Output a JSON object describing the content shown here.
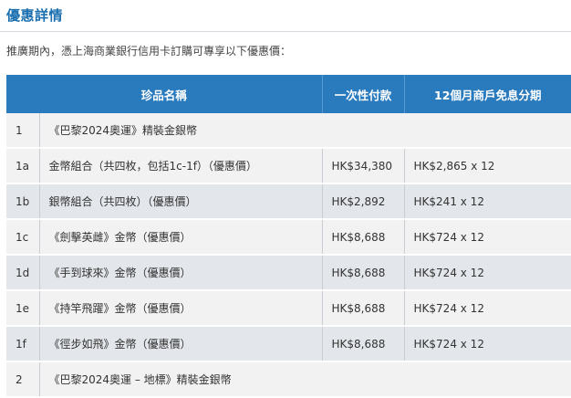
{
  "section_title": "優惠詳情",
  "intro": "推廣期內，憑上海商業銀行信用卡訂購可專享以下優惠價：",
  "table": {
    "headers": {
      "item": "珍品名稱",
      "lump_sum": "一次性付款",
      "installment": "12個月商戶免息分期"
    },
    "rows": [
      {
        "id": "1",
        "name": "《巴黎2024奧運》精裝金銀幣",
        "price": "",
        "installment": "",
        "group": true
      },
      {
        "id": "1a",
        "name": "金幣組合（共四枚，包括1c-1f）（優惠價）",
        "price": "HK$34,380",
        "installment": "HK$2,865 x 12"
      },
      {
        "id": "1b",
        "name": "銀幣組合（共四枚）（優惠價）",
        "price": "HK$2,892",
        "installment": "HK$241 x 12"
      },
      {
        "id": "1c",
        "name": "《劍擊英雌》金幣（優惠價）",
        "price": "HK$8,688",
        "installment": "HK$724 x 12"
      },
      {
        "id": "1d",
        "name": "《手到球來》金幣（優惠價）",
        "price": "HK$8,688",
        "installment": "HK$724 x 12"
      },
      {
        "id": "1e",
        "name": "《持竿飛躍》金幣（優惠價）",
        "price": "HK$8,688",
        "installment": "HK$724 x 12"
      },
      {
        "id": "1f",
        "name": "《徑步如飛》金幣（優惠價）",
        "price": "HK$8,688",
        "installment": "HK$724 x 12"
      },
      {
        "id": "2",
        "name": "《巴黎2024奧運 – 地標》精裝金銀幣",
        "price": "",
        "installment": "",
        "group": true
      }
    ]
  }
}
